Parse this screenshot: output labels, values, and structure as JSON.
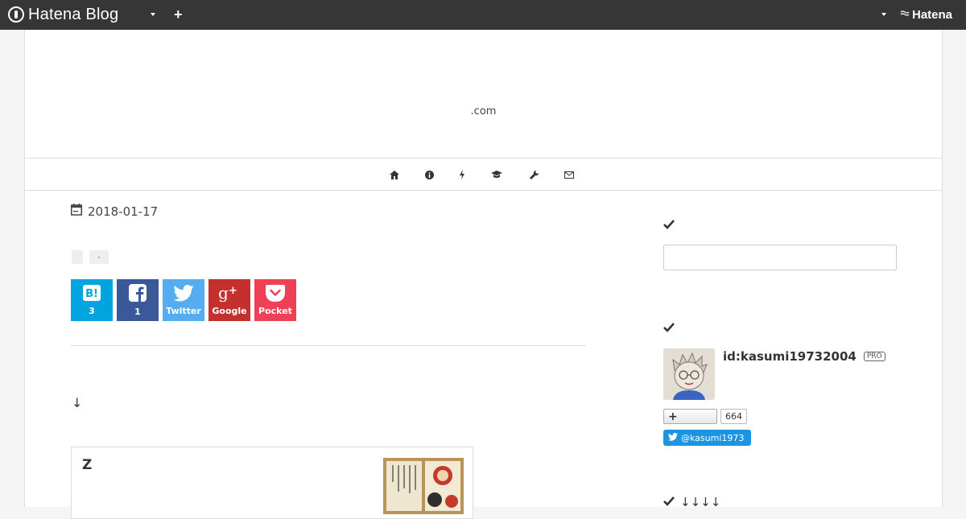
{
  "topbar": {
    "logo_text": "Hatena Blog",
    "add_label": "+",
    "brand": "Hatena"
  },
  "blog": {
    "title": ".com",
    "nav_icons": [
      "home-icon",
      "info-icon",
      "bolt-icon",
      "graduation-cap-icon",
      "wrench-icon",
      "envelope-icon"
    ]
  },
  "entry": {
    "date": "2018-01-17",
    "categories": [
      "",
      "-"
    ],
    "arrow_text": "↓",
    "card_title": "Z"
  },
  "share": {
    "hatena": {
      "label": "B!",
      "count": "3",
      "color": "#00a4de"
    },
    "facebook": {
      "label": "f",
      "count": "1",
      "color": "#3b5998"
    },
    "twitter": {
      "label": "Twitter",
      "color": "#55acee"
    },
    "google": {
      "label": "Google",
      "color": "#c4302b"
    },
    "pocket": {
      "label": "Pocket",
      "color": "#ef4056"
    }
  },
  "sidebar": {
    "search_placeholder": "",
    "user_id": "id:kasumi19732004",
    "pro_badge": "PRO",
    "follow_label": "+",
    "follower_count": "664",
    "twitter_handle": "@kasumi1973",
    "section3_arrows": "↓↓↓↓"
  }
}
